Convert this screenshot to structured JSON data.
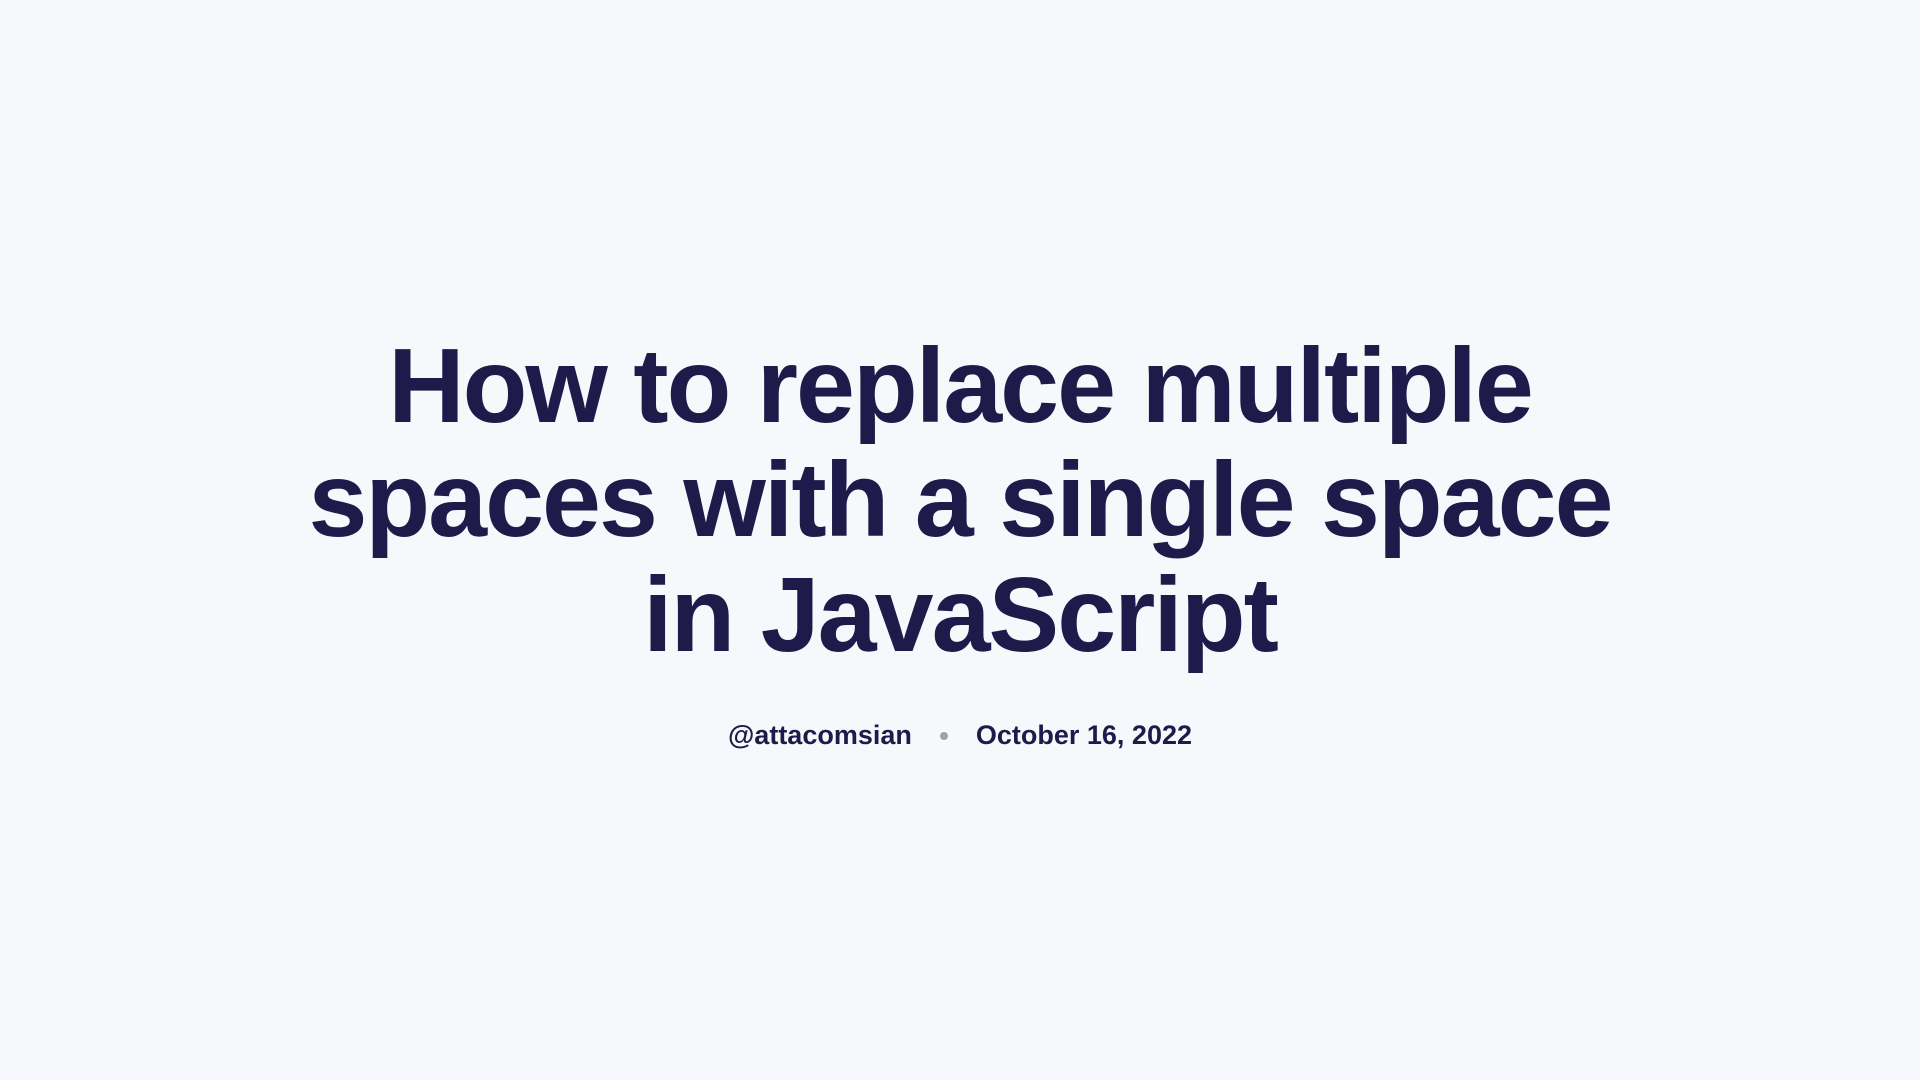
{
  "article": {
    "title": "How to replace multiple spaces with a single space in JavaScript",
    "author": "@attacomsian",
    "date": "October 16, 2022"
  }
}
